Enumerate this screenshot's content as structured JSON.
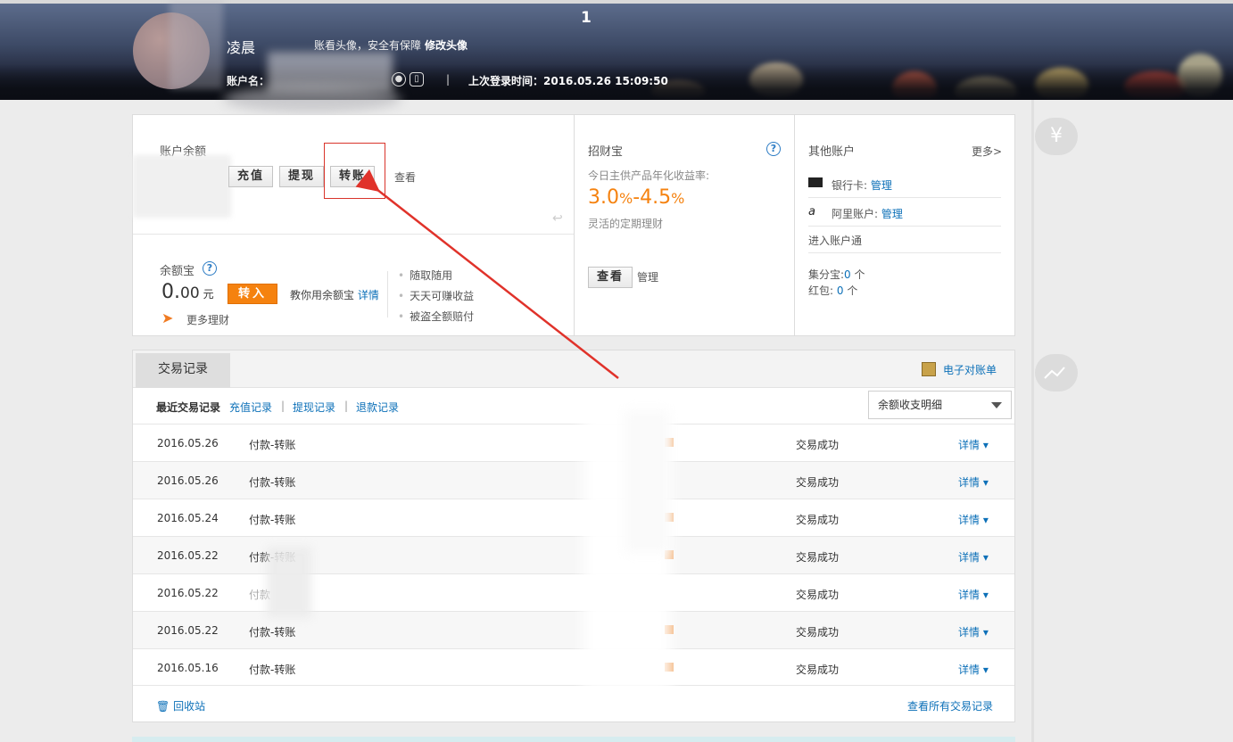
{
  "banner": {
    "counter": "1",
    "user_name": "凌晨",
    "avatar_tip": "账看头像，安全有保障",
    "avatar_edit": "修改头像",
    "account_label": "账户名：",
    "separator": "|",
    "last_login": "上次登录时间：2016.05.26 15:09:50",
    "icons": [
      "user-icon",
      "phone-icon"
    ]
  },
  "balance": {
    "title": "账户余额",
    "buttons": [
      "充值",
      "提现",
      "转账"
    ],
    "view_link": "查看",
    "return_glyph": "↩"
  },
  "yuebao": {
    "title": "余额宝",
    "amount_int": "0.",
    "amount_dec": "00",
    "unit": "元",
    "transfer_in": "转入",
    "tutorial": "教你用余额宝",
    "detail": "详情",
    "more": "更多理财",
    "features": [
      "随取随用",
      "天天可赚收益",
      "被盗全额赔付"
    ]
  },
  "zhaocaibao": {
    "title": "招财宝",
    "rate_label": "今日主供产品年化收益率:",
    "rate_low": "3.0",
    "rate_high": "4.5",
    "percent": "%",
    "dash": "-",
    "desc": "灵活的定期理财",
    "view_btn": "查看",
    "manage": "管理"
  },
  "other": {
    "title": "其他账户",
    "more": "更多>",
    "bank_label": "银行卡:",
    "bank_manage": "管理",
    "ali_label": "阿里账户:",
    "ali_manage": "管理",
    "enter_link": "进入账户通",
    "jifen_label": "集分宝:",
    "jifen_value": "0",
    "jifen_unit": "个",
    "hongbao_label": "红包:",
    "hongbao_value": "0",
    "hongbao_unit": "个"
  },
  "side": {
    "yen": "¥"
  },
  "records": {
    "tab": "交易记录",
    "statement": "电子对账单",
    "recent": "最近交易记录",
    "filters": [
      "充值记录",
      "提现记录",
      "退款记录"
    ],
    "sep": "|",
    "select_value": "余额收支明细",
    "rows": [
      {
        "date": "2016.05.26",
        "desc": "付款-转账",
        "status": "交易成功",
        "detail": "详情"
      },
      {
        "date": "2016.05.26",
        "desc": "付款-转账",
        "status": "交易成功",
        "detail": "详情"
      },
      {
        "date": "2016.05.24",
        "desc": "付款-转账",
        "status": "交易成功",
        "detail": "详情"
      },
      {
        "date": "2016.05.22",
        "desc": "付款-转账",
        "status": "交易成功",
        "detail": "详情"
      },
      {
        "date": "2016.05.22",
        "desc": "付款",
        "status": "交易成功",
        "detail": "详情"
      },
      {
        "date": "2016.05.22",
        "desc": "付款-转账",
        "status": "交易成功",
        "detail": "详情"
      },
      {
        "date": "2016.05.16",
        "desc": "付款-转账",
        "status": "交易成功",
        "detail": "详情"
      }
    ],
    "partial_amount": "00",
    "recycle": "回收站",
    "all_records": "查看所有交易记录"
  },
  "colors": {
    "accent": "#0c70b8",
    "orange": "#f5820f",
    "annotation_red": "#e0322a"
  }
}
